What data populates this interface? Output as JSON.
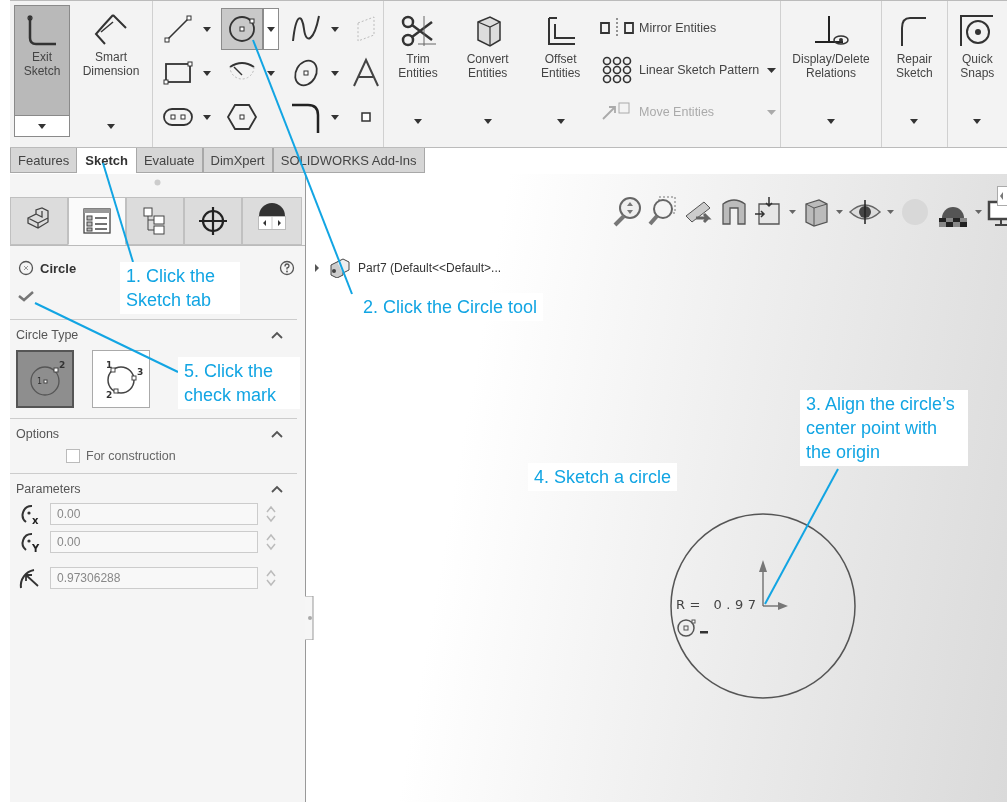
{
  "ribbon": {
    "sketch_buttons": [
      {
        "kind": "exit",
        "label": "Exit Sketch",
        "selected": true
      },
      {
        "kind": "dimension",
        "label": "Smart Dimension",
        "selected": false
      }
    ],
    "tools": [
      {
        "kind": "line",
        "selected": false,
        "dropdown": true
      },
      {
        "kind": "circle",
        "selected": true,
        "dropdown": true
      },
      {
        "kind": "spline",
        "selected": false,
        "dropdown": true
      },
      {
        "kind": "plane",
        "selected": false,
        "dropdown": false
      },
      {
        "kind": "rectangle",
        "selected": false,
        "dropdown": true
      },
      {
        "kind": "arc",
        "selected": false,
        "dropdown": true
      },
      {
        "kind": "ellipse",
        "selected": false,
        "dropdown": true
      },
      {
        "kind": "text",
        "selected": false,
        "dropdown": false
      },
      {
        "kind": "slot",
        "selected": false,
        "dropdown": true
      },
      {
        "kind": "polygon",
        "selected": false,
        "dropdown": false
      },
      {
        "kind": "fillet",
        "selected": false,
        "dropdown": true
      },
      {
        "kind": "point",
        "selected": false,
        "dropdown": false
      }
    ],
    "modify_buttons": [
      {
        "kind": "trim",
        "label": "Trim Entities"
      },
      {
        "kind": "convert",
        "label": "Convert Entities"
      },
      {
        "kind": "offset",
        "label": "Offset Entities"
      }
    ],
    "modify_list": [
      {
        "kind": "mirror",
        "label": "Mirror Entities",
        "disabled": false
      },
      {
        "kind": "pattern",
        "label": "Linear Sketch Pattern",
        "disabled": false
      },
      {
        "kind": "move",
        "label": "Move Entities",
        "disabled": true
      }
    ],
    "relation_buttons": [
      {
        "kind": "relations",
        "label": "Display/Delete Relations"
      },
      {
        "kind": "repair",
        "label": "Repair Sketch"
      },
      {
        "kind": "snaps",
        "label": "Quick Snaps"
      }
    ]
  },
  "tabs": [
    {
      "label": "Features",
      "selected": false
    },
    {
      "label": "Sketch",
      "selected": true
    },
    {
      "label": "Evaluate",
      "selected": false
    },
    {
      "label": "DimXpert",
      "selected": false
    },
    {
      "label": "SOLIDWORKS Add-Ins",
      "selected": false
    }
  ],
  "panel_tabs": [
    {
      "kind": "features",
      "selected": false
    },
    {
      "kind": "properties",
      "selected": true
    },
    {
      "kind": "configurations",
      "selected": false
    },
    {
      "kind": "dimxpert",
      "selected": false
    },
    {
      "kind": "appearance",
      "selected": false
    }
  ],
  "property_manager": {
    "title": "Circle",
    "circle_type": {
      "heading": "Circle Type",
      "expanded": true,
      "options": [
        {
          "kind": "center",
          "selected": true,
          "points": [
            "1",
            "2"
          ]
        },
        {
          "kind": "perimeter",
          "selected": false,
          "points": [
            "1",
            "3",
            "2"
          ]
        }
      ]
    },
    "options": {
      "heading": "Options",
      "expanded": true,
      "construction": {
        "label": "For construction",
        "checked": false
      }
    },
    "parameters": {
      "heading": "Parameters",
      "expanded": true,
      "fields": [
        {
          "kind": "center",
          "axis": "x",
          "value": "0.00"
        },
        {
          "kind": "center",
          "axis": "Y",
          "value": "0.00"
        },
        {
          "kind": "radius",
          "value": "0.97306288"
        }
      ]
    }
  },
  "tree": {
    "label": "Part7 (Default<<Default>...",
    "expanded": false
  },
  "sketch": {
    "dimension": "R= 0.97"
  },
  "callouts": [
    {
      "text": "1. Click the Sketch tab",
      "leader": true
    },
    {
      "text": "2. Click the Circle tool",
      "leader": true
    },
    {
      "text": "3. Align the circle’s center point with the origin",
      "leader": true
    },
    {
      "text": "4. Sketch a circle",
      "leader": false
    },
    {
      "text": "5. Click the check mark",
      "leader": true
    }
  ]
}
